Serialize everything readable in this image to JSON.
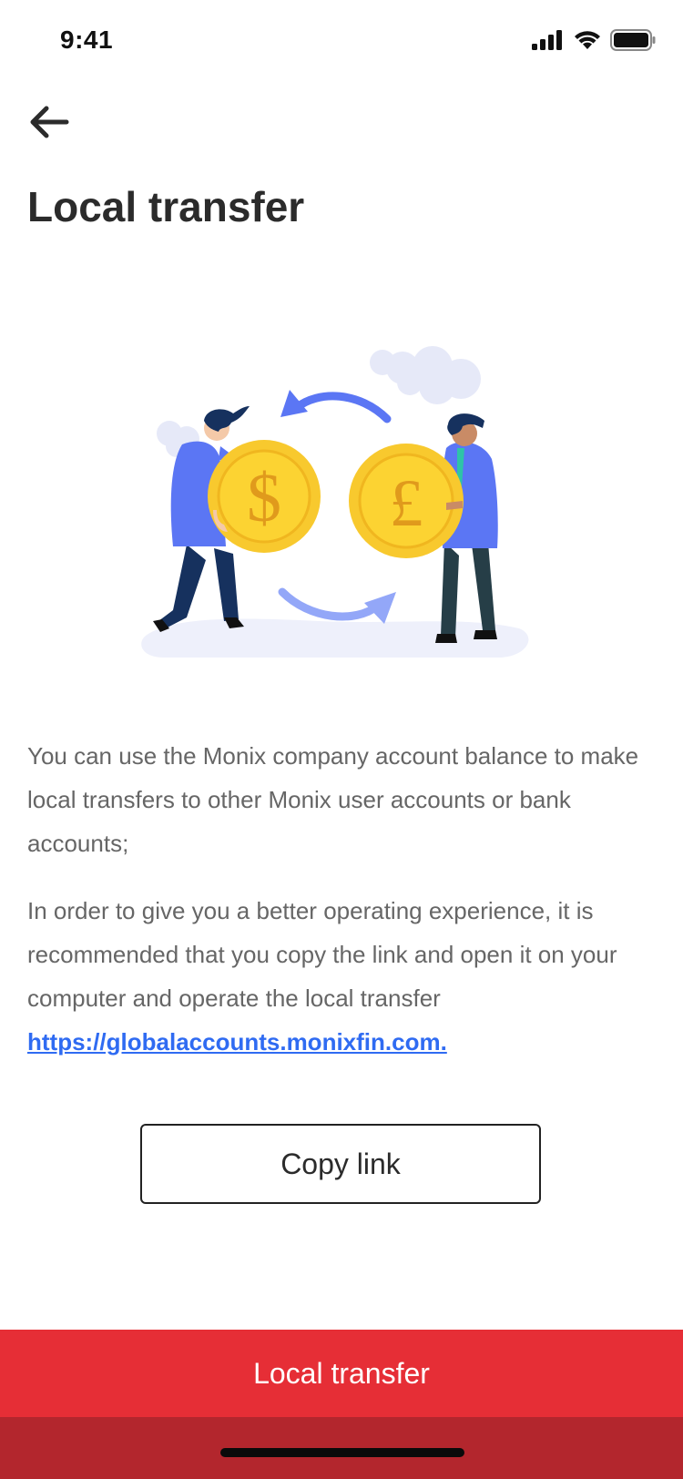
{
  "status_bar": {
    "time": "9:41",
    "icons": [
      "cellular-signal-icon",
      "wifi-icon",
      "battery-icon"
    ]
  },
  "nav": {
    "back_icon": "back-arrow-icon"
  },
  "page": {
    "title": "Local transfer"
  },
  "illustration": {
    "icons": [
      "dollar-coin-icon",
      "pound-coin-icon",
      "exchange-arrows-icon",
      "person-icon",
      "cloud-icon"
    ]
  },
  "content": {
    "paragraph_1": "You can use the Monix company account balance to make local transfers to other Monix user accounts or bank accounts;",
    "paragraph_2": "In order to give you a better operating experience, it is recommended that you copy the link and open it on your computer and operate the local transfer",
    "link": "https://globalaccounts.monixfin.com."
  },
  "buttons": {
    "copy_link": "Copy link",
    "primary": "Local transfer"
  },
  "colors": {
    "primary": "#e62e36",
    "primary_dark": "#b3262d",
    "link": "#2f6bf2",
    "coin": "#fcc419",
    "shirt": "#5b76f4"
  }
}
